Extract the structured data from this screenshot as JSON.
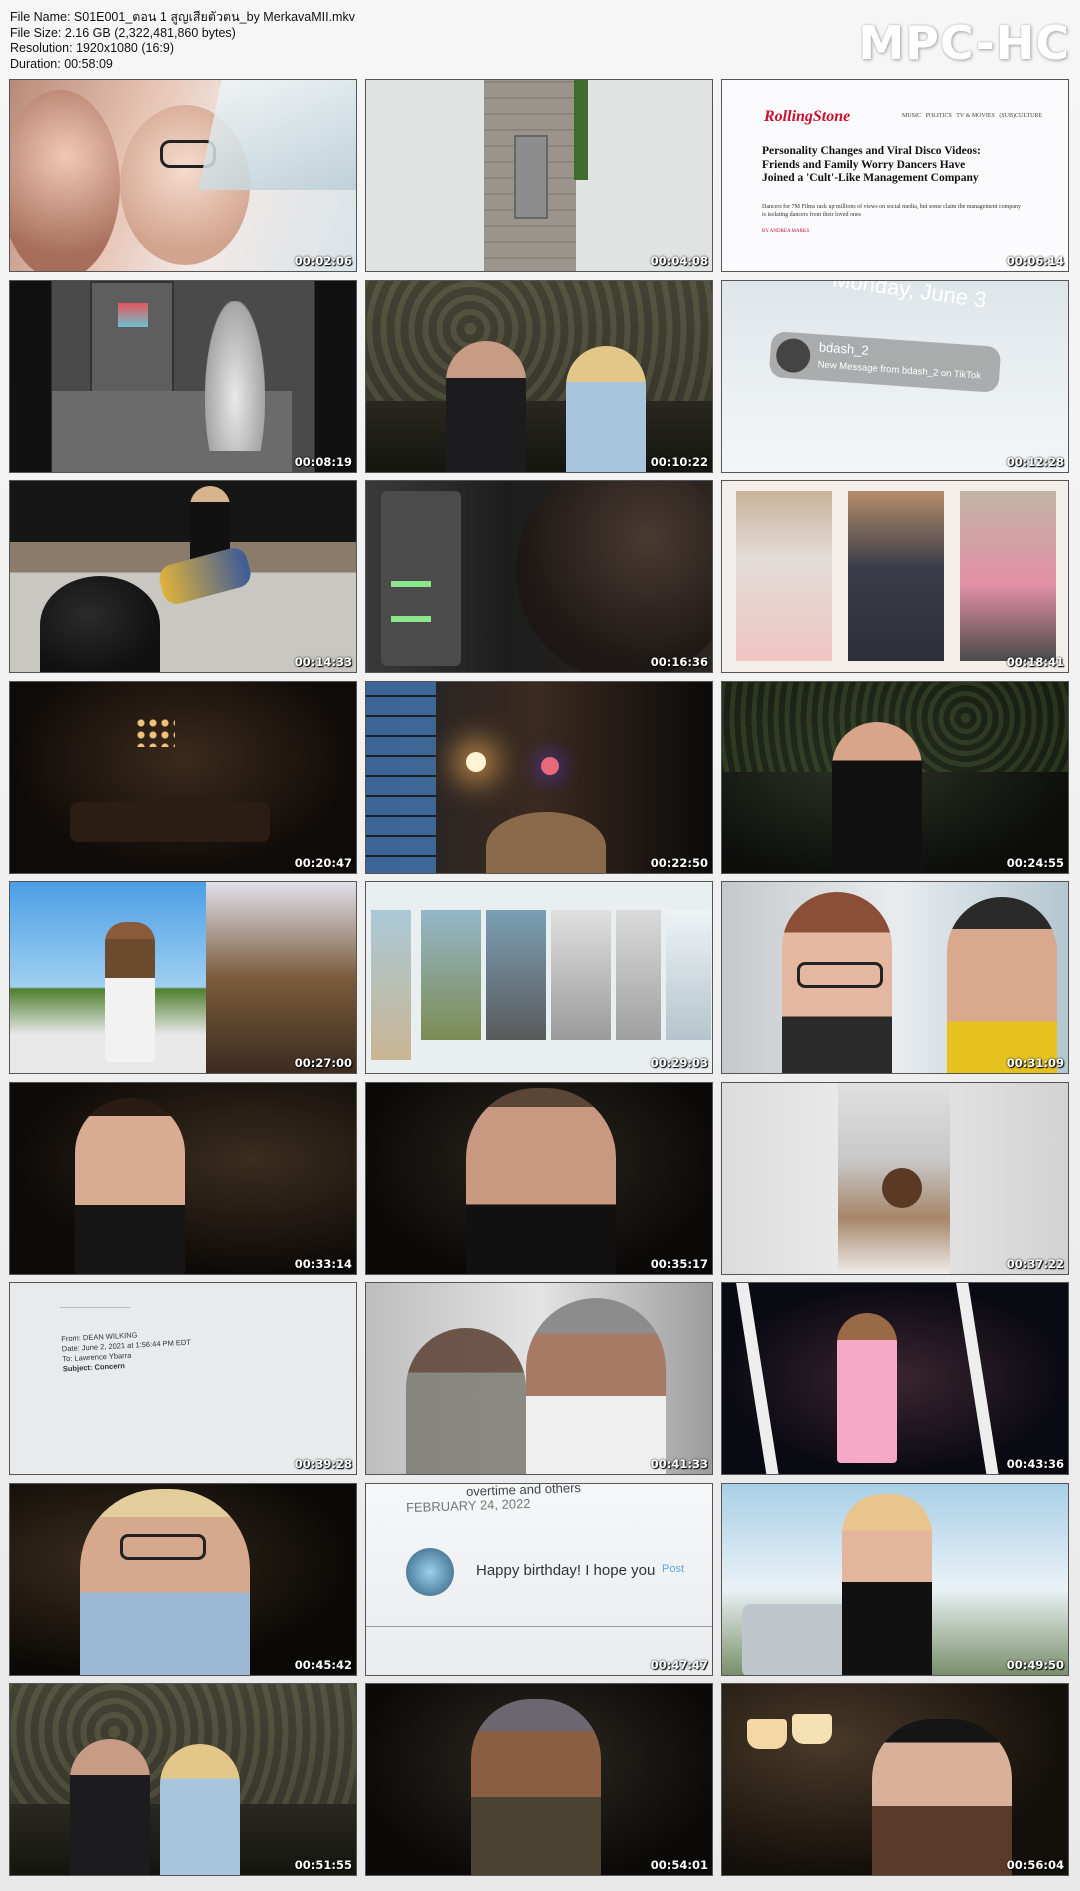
{
  "header": {
    "file_name": "File Name: S01E001_ตอน 1 สูญเสียตัวตน_by MerkavaMII.mkv",
    "file_size": "File Size: 2.16 GB (2,322,481,860 bytes)",
    "resolution": "Resolution: 1920x1080 (16:9)",
    "duration": "Duration: 00:58:09",
    "logo": "MPC-HC"
  },
  "thumbnails": [
    {
      "time": "00:02:06"
    },
    {
      "time": "00:04:08"
    },
    {
      "time": "00:06:14"
    },
    {
      "time": "00:08:19"
    },
    {
      "time": "00:10:22"
    },
    {
      "time": "00:12:28"
    },
    {
      "time": "00:14:33"
    },
    {
      "time": "00:16:36"
    },
    {
      "time": "00:18:41"
    },
    {
      "time": "00:20:47"
    },
    {
      "time": "00:22:50"
    },
    {
      "time": "00:24:55"
    },
    {
      "time": "00:27:00"
    },
    {
      "time": "00:29:03"
    },
    {
      "time": "00:31:09"
    },
    {
      "time": "00:33:14"
    },
    {
      "time": "00:35:17"
    },
    {
      "time": "00:37:22"
    },
    {
      "time": "00:39:28"
    },
    {
      "time": "00:41:33"
    },
    {
      "time": "00:43:36"
    },
    {
      "time": "00:45:42"
    },
    {
      "time": "00:47:47"
    },
    {
      "time": "00:49:50"
    },
    {
      "time": "00:51:55"
    },
    {
      "time": "00:54:01"
    },
    {
      "time": "00:56:04"
    }
  ],
  "rolling_stone": {
    "masthead": "RollingStone",
    "nav": [
      "MUSIC",
      "POLITICS",
      "TV & MOVIES",
      "(SUB)CULTURE"
    ],
    "headline": "Personality Changes and Viral Disco Videos: Friends and Family Worry Dancers Have Joined a 'Cult'-Like Management Company",
    "dek": "Dancers for 7M Films rack up millions of views on social media, but some claim the management company is isolating dancers from their loved ones",
    "byline": "BY ANDREA MARKS"
  },
  "phone_notice": {
    "date": "Monday, June 3",
    "sender": "bdash_2",
    "message": "New Message from bdash_2 on TikTok"
  },
  "email": {
    "from": "From: DEAN WILKING",
    "date": "Date: June 2, 2021 at 1:56:44 PM EDT",
    "to": "To: Lawrence Ybarra",
    "subject": "Subject: Concern"
  },
  "birthday_post": {
    "header": "overtime and others",
    "date": "FEBRUARY 24, 2022",
    "text": "Happy birthday! I hope you",
    "post_label": "Post"
  }
}
